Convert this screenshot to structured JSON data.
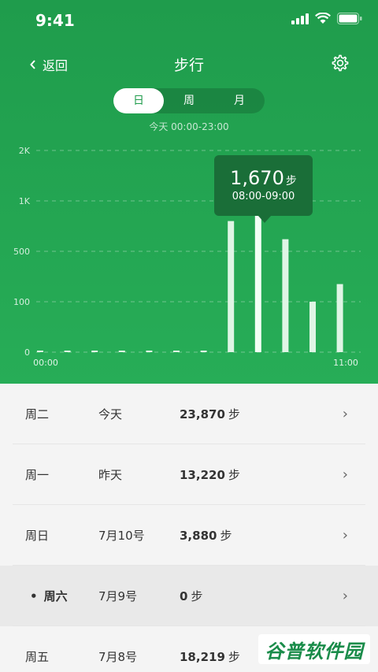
{
  "status": {
    "time": "9:41"
  },
  "nav": {
    "back_label": "返回",
    "title": "步行"
  },
  "segments": [
    "日",
    "周",
    "月"
  ],
  "active_segment": 0,
  "range_label": "今天 00:00-23:00",
  "tooltip": {
    "value": "1,670",
    "unit": "步",
    "range": "08:00-09:00"
  },
  "chart_data": {
    "type": "bar",
    "y_tick_labels": [
      "0",
      "100",
      "500",
      "1K",
      "2K"
    ],
    "y_tick_values": [
      0,
      100,
      500,
      1000,
      2000
    ],
    "x_tick_labels": [
      "00:00",
      "11:00"
    ],
    "x": [
      "00:00",
      "01:00",
      "02:00",
      "03:00",
      "04:00",
      "05:00",
      "06:00",
      "07:00",
      "08:00",
      "09:00",
      "10:00",
      "11:00"
    ],
    "values": [
      0,
      0,
      0,
      0,
      0,
      0,
      0,
      800,
      1670,
      620,
      100,
      240
    ],
    "selected_index": 8,
    "grid": true
  },
  "list": [
    {
      "day": "周二",
      "date": "今天",
      "steps": "23,870",
      "unit": "步"
    },
    {
      "day": "周一",
      "date": "昨天",
      "steps": "13,220",
      "unit": "步"
    },
    {
      "day": "周日",
      "date": "7月10号",
      "steps": "3,880",
      "unit": "步"
    },
    {
      "day": "周六",
      "date": "7月9号",
      "steps": "0",
      "unit": "步",
      "highlight": true
    },
    {
      "day": "周五",
      "date": "7月8号",
      "steps": "18,219",
      "unit": "步"
    }
  ],
  "watermark": "谷普软件园",
  "colors": {
    "green": "#1f9c4c",
    "bar": "#e4f7e9",
    "tooltip": "#1a6e38"
  }
}
